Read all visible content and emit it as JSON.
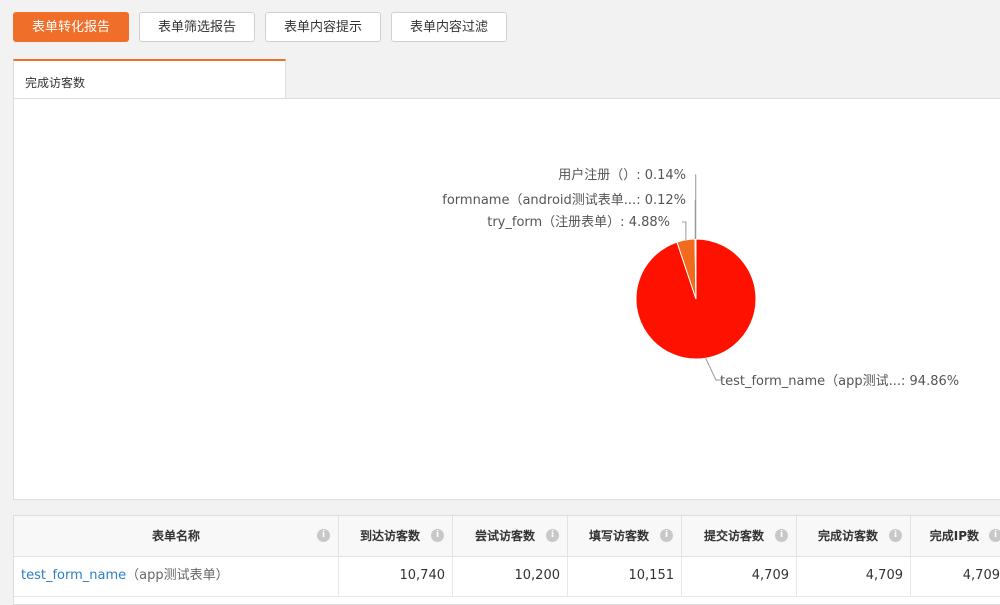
{
  "toolbar": {
    "buttons": [
      {
        "label": "表单转化报告",
        "active": true
      },
      {
        "label": "表单筛选报告",
        "active": false
      },
      {
        "label": "表单内容提示",
        "active": false
      },
      {
        "label": "表单内容过滤",
        "active": false
      }
    ]
  },
  "tab": {
    "label": "完成访客数"
  },
  "chart_data": {
    "type": "pie",
    "slices": [
      {
        "label": "test_form_name（app测试...: 94.86%",
        "value": 94.86,
        "color": "#ff1100"
      },
      {
        "label": "try_form（注册表单）: 4.88%",
        "value": 4.88,
        "color": "#f26b1d"
      },
      {
        "label": "formname（android测试表单...: 0.12%",
        "value": 0.12,
        "color": "#f7c12d"
      },
      {
        "label": "用户注册（）: 0.14%",
        "value": 0.14,
        "color": "#3a86d8"
      }
    ]
  },
  "table": {
    "headers": [
      "表单名称",
      "到达访客数",
      "尝试访客数",
      "填写访客数",
      "提交访客数",
      "完成访客数",
      "完成IP数"
    ],
    "info_icon": "i",
    "rows": [
      {
        "name": "test_form_name",
        "desc": "（app测试表单）",
        "values": [
          "10,740",
          "10,200",
          "10,151",
          "4,709",
          "4,709",
          "4,709"
        ]
      }
    ]
  }
}
